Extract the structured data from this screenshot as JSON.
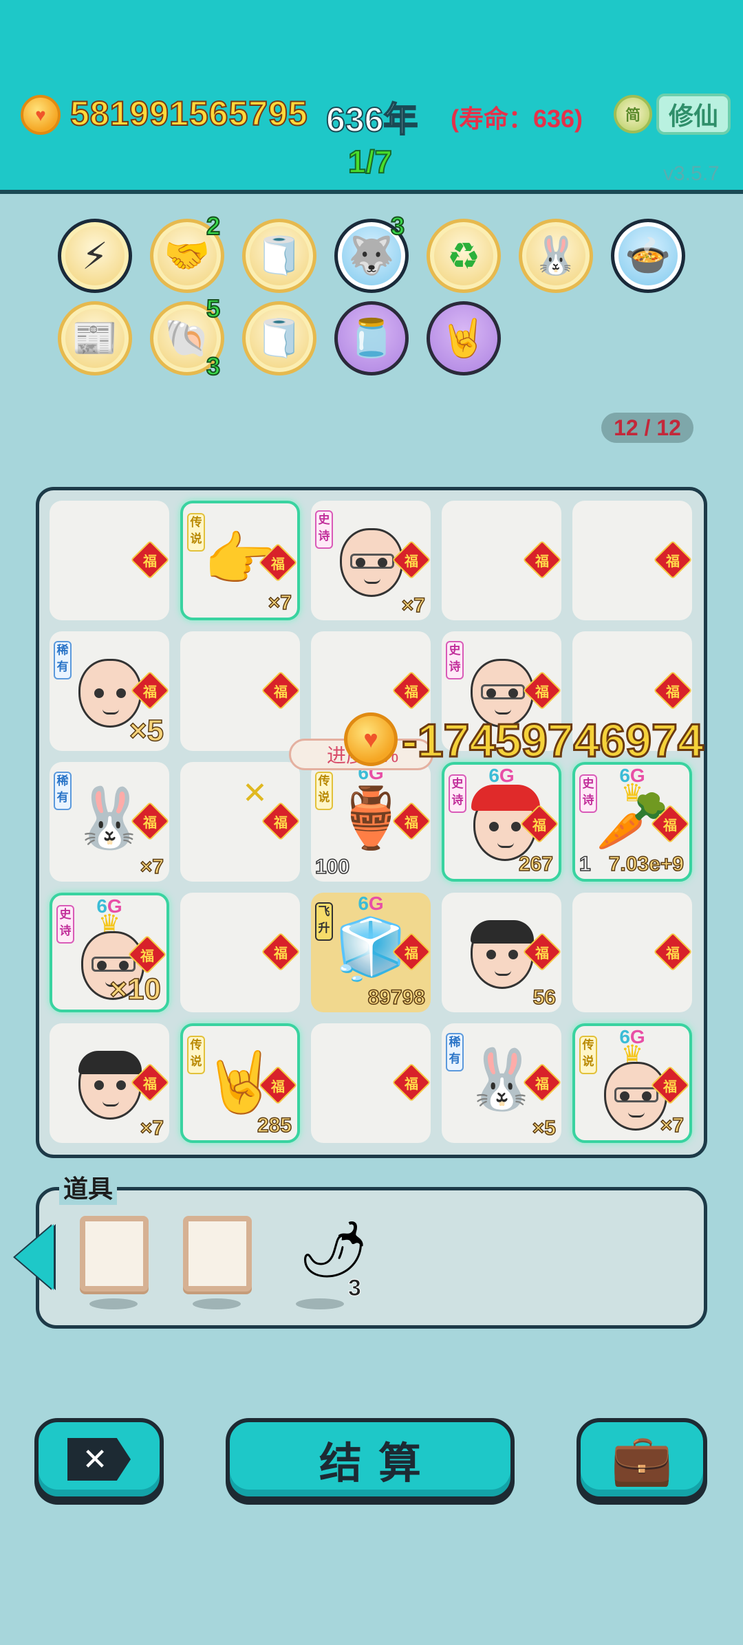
{
  "header": {
    "money": "581991565795",
    "year": "636年",
    "lifespan": "(寿命：636)",
    "jian_label": "简",
    "xiuxian_label": "修仙",
    "round": "1/7",
    "version": "v3.5.7"
  },
  "relics": [
    {
      "icon": "lightning-icon",
      "glyph": "⚡",
      "badge": ""
    },
    {
      "icon": "handshake-icon",
      "glyph": "🤝",
      "badge": "2"
    },
    {
      "icon": "tissue-box-icon",
      "glyph": "🧻",
      "badge": ""
    },
    {
      "icon": "husky-dog-icon",
      "glyph": "🐺",
      "badge": "3"
    },
    {
      "icon": "recycle-icon",
      "glyph": "♻",
      "badge": ""
    },
    {
      "icon": "rabbit-icon",
      "glyph": "🐰",
      "badge": ""
    },
    {
      "icon": "cooking-pot-icon",
      "glyph": "🍲",
      "badge": ""
    },
    {
      "icon": "time-magazine-icon",
      "glyph": "📰",
      "badge": ""
    },
    {
      "icon": "shell-icon",
      "glyph": "🐚",
      "badge": "5",
      "badge2": "3"
    },
    {
      "icon": "tissue-box-icon",
      "glyph": "🧻",
      "badge": ""
    },
    {
      "icon": "jar-icon",
      "glyph": "🫙",
      "badge": ""
    },
    {
      "icon": "rock-hand-icon",
      "glyph": "🤘",
      "badge": ""
    }
  ],
  "slots": "12 / 12",
  "board": {
    "fu": "福",
    "tags": {
      "legend": "传说",
      "epic": "史诗",
      "rare": "稀有",
      "fly": "飞升"
    },
    "g6": {
      "six": "6",
      "g": "G"
    },
    "cells": [
      {
        "count": ""
      },
      {
        "count": "×7",
        "icon": "pointing-hand-icon"
      },
      {
        "count": "×7",
        "icon": "old-man-glasses-icon"
      },
      {
        "count": ""
      },
      {
        "count": ""
      },
      {
        "count": "×5",
        "icon": "bald-man-icon"
      },
      {
        "count": ""
      },
      {
        "count": ""
      },
      {
        "count": "",
        "icon": "old-man-glasses-icon"
      },
      {
        "count": ""
      },
      {
        "count": "×7",
        "icon": "rabbit-icon"
      },
      {
        "count": ""
      },
      {
        "count": "100",
        "icon": "green-vase-icon"
      },
      {
        "count": "267",
        "icon": "red-cap-kid-icon"
      },
      {
        "count": "7.03e+9",
        "count_left": "1",
        "icon": "crowned-carrot-icon"
      },
      {
        "count": "×10",
        "icon": "crowned-old-man-icon"
      },
      {
        "count": ""
      },
      {
        "count": "89798",
        "icon": "fridge-icon"
      },
      {
        "count": "56",
        "icon": "man-icon"
      },
      {
        "count": ""
      },
      {
        "count": "×7",
        "icon": "man-icon"
      },
      {
        "count": "285",
        "icon": "rock-hand-icon"
      },
      {
        "count": ""
      },
      {
        "count": "×5",
        "icon": "rabbit-icon"
      },
      {
        "count": "×7",
        "icon": "crowned-grinning-man-icon"
      }
    ]
  },
  "overlay": {
    "float_number": "-17459746974",
    "progress_text": "进度 3%"
  },
  "items": {
    "title": "道具",
    "pepper_count": "3"
  },
  "buttons": {
    "close": "✕",
    "settle": "结算"
  }
}
